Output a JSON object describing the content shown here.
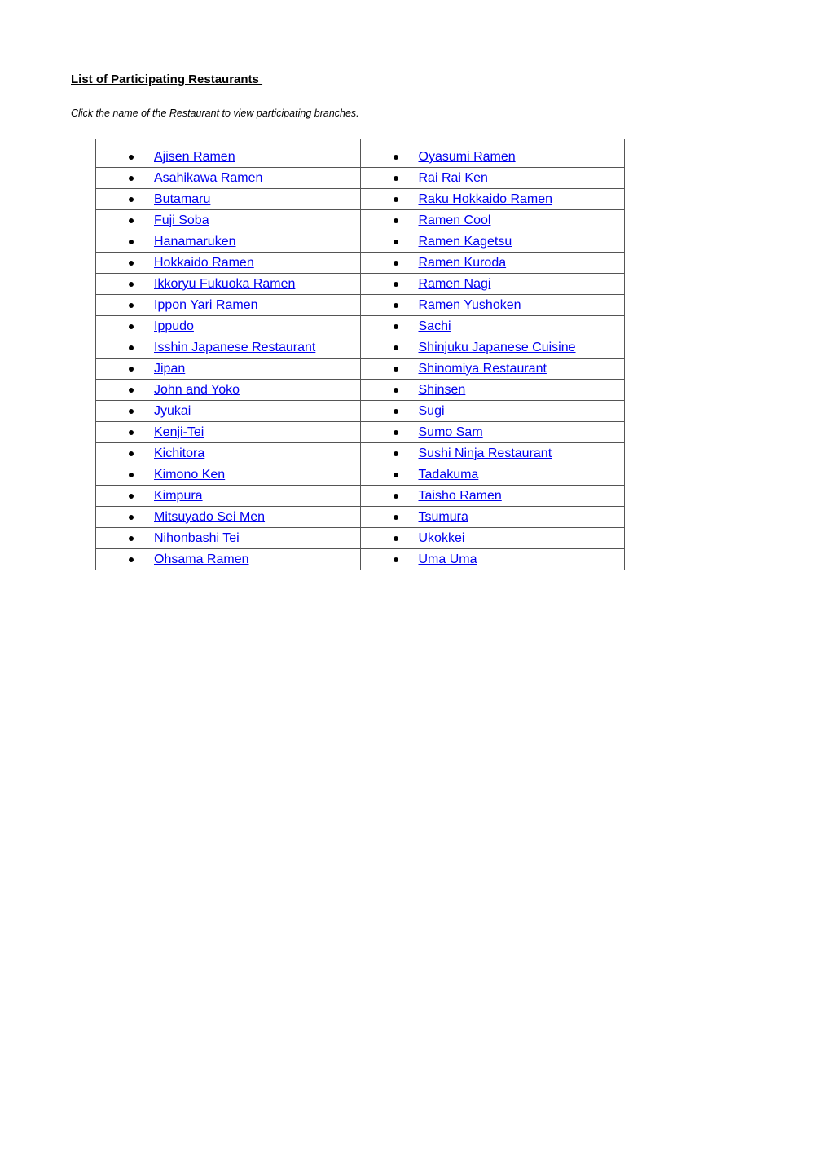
{
  "document": {
    "title": "List of Participating Restaurants ",
    "instructions": "Click the name of the Restaurant to view participating branches."
  },
  "colors": {
    "link": "#0000ee",
    "text": "#000000",
    "border": "#555555"
  },
  "restaurants": {
    "left_column": [
      "Ajisen Ramen",
      "Asahikawa Ramen",
      "Butamaru",
      "Fuji Soba",
      "Hanamaruken",
      "Hokkaido Ramen",
      "Ikkoryu Fukuoka Ramen",
      "Ippon Yari Ramen",
      "Ippudo",
      "Isshin Japanese Restaurant",
      "Jipan",
      "John and Yoko",
      "Jyukai",
      "Kenji-Tei",
      "Kichitora",
      "Kimono Ken",
      "Kimpura",
      "Mitsuyado Sei Men",
      "Nihonbashi Tei",
      "Ohsama Ramen"
    ],
    "right_column": [
      "Oyasumi Ramen",
      "Rai Rai Ken",
      "Raku Hokkaido Ramen",
      "Ramen Cool",
      "Ramen Kagetsu",
      "Ramen Kuroda",
      "Ramen Nagi",
      "Ramen Yushoken",
      "Sachi",
      "Shinjuku Japanese Cuisine",
      "Shinomiya Restaurant",
      "Shinsen",
      "Sugi",
      "Sumo Sam",
      "Sushi Ninja Restaurant",
      "Tadakuma",
      "Taisho Ramen",
      "Tsumura",
      "Ukokkei",
      "Uma Uma"
    ]
  }
}
